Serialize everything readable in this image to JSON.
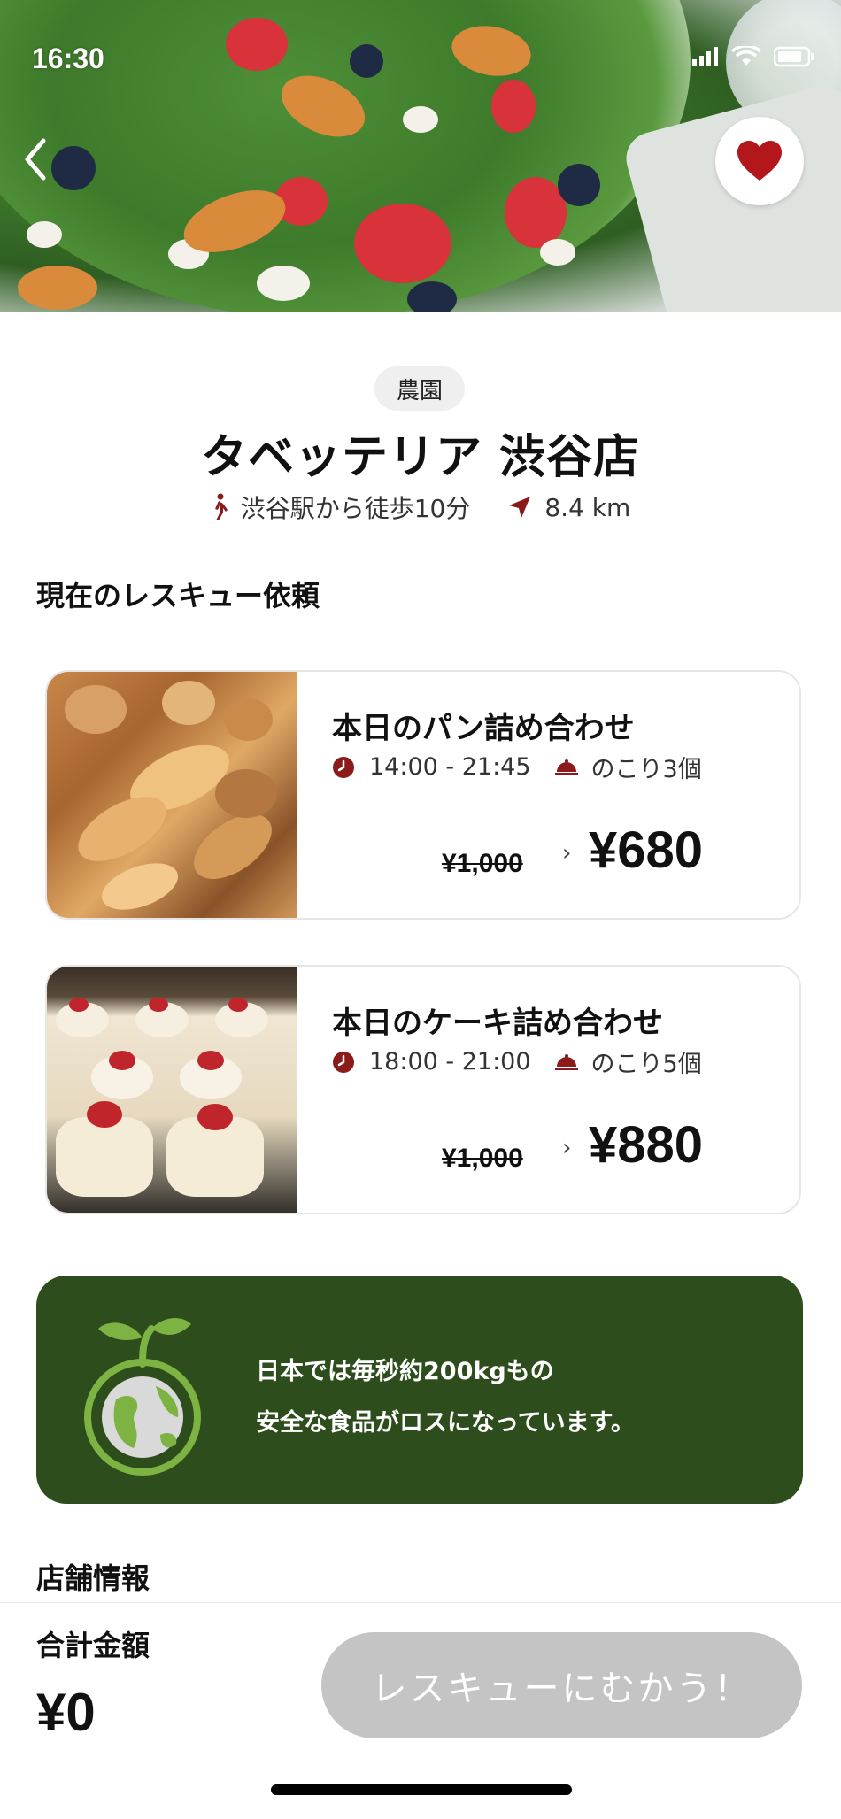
{
  "status_bar": {
    "time": "16:30"
  },
  "store": {
    "category_tag": "農園",
    "name": "タベッテリア 渋谷店",
    "walk_info": "渋谷駅から徒歩10分",
    "distance": "8.4 km"
  },
  "sections": {
    "current_requests": "現在のレスキュー依頼",
    "store_info": "店舗情報"
  },
  "offers": [
    {
      "title": "本日のパン詰め合わせ",
      "time_range": "14:00 - 21:45",
      "remaining": "のこり3個",
      "original_price": "¥1,000",
      "arrow": "›",
      "price": "¥680"
    },
    {
      "title": "本日のケーキ詰め合わせ",
      "time_range": "18:00 - 21:00",
      "remaining": "のこり5個",
      "original_price": "¥1,000",
      "arrow": "›",
      "price": "¥880"
    }
  ],
  "banner": {
    "line1": "日本では毎秒約200kgもの",
    "line2": "安全な食品がロスになっています。"
  },
  "footer": {
    "total_label": "合計金額",
    "total_value": "¥0",
    "cta_label": "レスキューにむかう！"
  },
  "colors": {
    "accent_red": "#8b1a1a",
    "heart_red": "#b3161b",
    "banner_green": "#2e4d1c",
    "disabled_button": "#c4c4c4"
  },
  "icons": [
    "chevron-left-icon",
    "heart-icon",
    "walking-icon",
    "location-arrow-icon",
    "clock-icon",
    "cloche-icon",
    "sprout-globe-icon"
  ]
}
